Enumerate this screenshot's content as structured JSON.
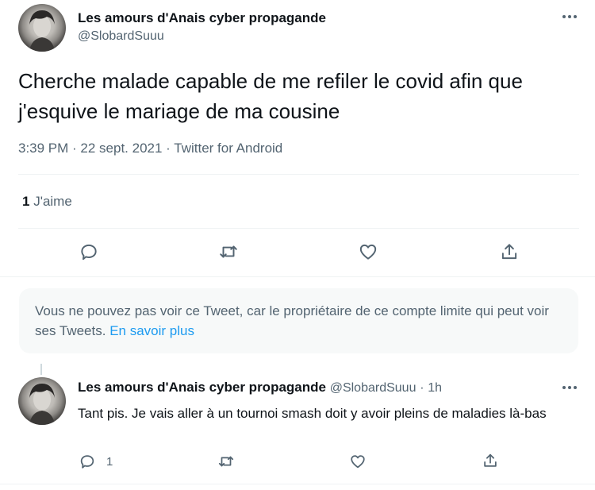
{
  "main_tweet": {
    "author_name": "Les amours d'Anais cyber propagande",
    "author_handle": "@SlobardSuuu",
    "text": "Cherche malade capable de me refiler le covid afin que j'esquive le mariage de ma cousine",
    "timestamp": "3:39 PM · 22 sept. 2021 · Twitter for Android",
    "likes_count": "1",
    "likes_label": "J'aime"
  },
  "notice": {
    "text": "Vous ne pouvez pas voir ce Tweet, car le propriétaire de ce compte limite qui peut voir ses Tweets.",
    "link": "En savoir plus"
  },
  "reply": {
    "author_name": "Les amours d'Anais cyber propagande",
    "author_handle": "@SlobardSuuu",
    "separator": "·",
    "time": "1h",
    "text": "Tant pis. Je vais aller à un tournoi smash doit y avoir pleins de maladies là-bas",
    "reply_count": "1"
  },
  "icons": [
    "reply-icon",
    "retweet-icon",
    "like-icon",
    "share-icon",
    "more-icon"
  ],
  "colors": {
    "text": "#0f1419",
    "muted": "#536471",
    "link": "#1d9bf0",
    "notice_bg": "#f7f9f9",
    "divider": "#eff3f4"
  }
}
